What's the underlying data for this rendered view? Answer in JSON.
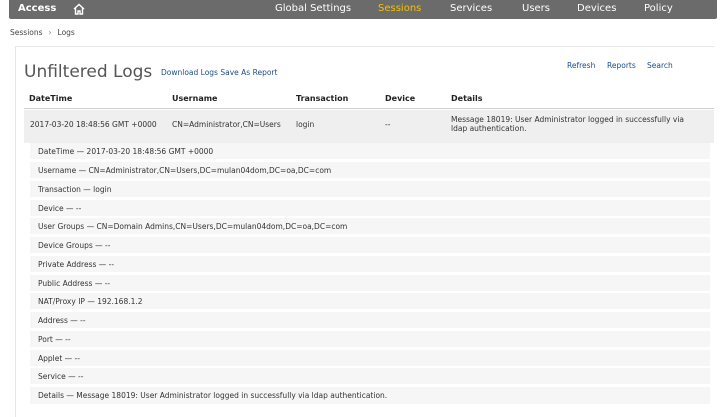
{
  "nav": {
    "brand": "Access",
    "items": [
      "Global Settings",
      "Sessions",
      "Services",
      "Users",
      "Devices",
      "Policy"
    ]
  },
  "breadcrumb": {
    "parent": "Sessions",
    "separator": "›",
    "current": "Logs"
  },
  "page": {
    "title": "Unfiltered Logs",
    "download_link": "Download Logs",
    "save_report_link": "Save As Report",
    "links": [
      "Refresh",
      "Reports",
      "Search"
    ]
  },
  "table": {
    "headers": [
      "DateTime",
      "Username",
      "Transaction",
      "Device",
      "Details"
    ],
    "row": {
      "datetime": "2017-03-20 18:48:56 GMT +0000",
      "username": "CN=Administrator,CN=Users",
      "transaction": "login",
      "device": "--",
      "details_line1": "Message 18019: User Administrator logged in successfully via",
      "details_line2": "ldap authentication."
    }
  },
  "details": [
    "DateTime  —  2017-03-20 18:48:56 GMT +0000",
    "Username  —  CN=Administrator,CN=Users,DC=mulan04dom,DC=oa,DC=com",
    "Transaction  —  login",
    "Device  —  --",
    "User Groups  —  CN=Domain Admins,CN=Users,DC=mulan04dom,DC=oa,DC=com",
    "Device Groups  —  --",
    "Private Address  —  --",
    "Public Address  —  --",
    "NAT/Proxy IP  —  192.168.1.2",
    "Address  —  --",
    "Port  —  --",
    "Applet  —  --",
    "Service  —  --",
    "Details  —  Message 18019: User Administrator logged in successfully via ldap authentication."
  ],
  "colors": {
    "nav_bg": "#6b6b6b",
    "active": "#f2c200",
    "link": "#1d4e89"
  }
}
